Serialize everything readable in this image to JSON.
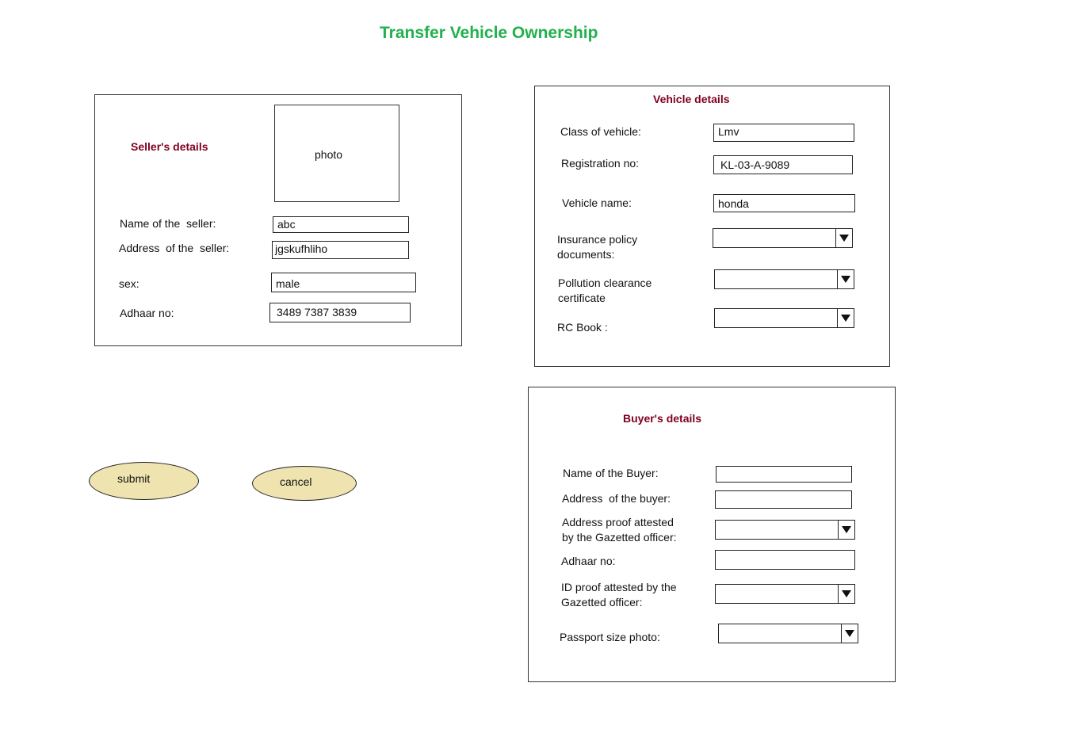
{
  "page_title": "Transfer Vehicle Ownership",
  "seller": {
    "heading": "Seller's details",
    "photo_label": "photo",
    "name_label": "Name of the  seller:",
    "name_value": "abc",
    "address_label": "Address  of the  seller:",
    "address_value": "jgskufhliho",
    "sex_label": "sex:",
    "sex_value": "male",
    "adhaar_label": "Adhaar no:",
    "adhaar_value": "3489 7387 3839"
  },
  "vehicle": {
    "heading": "Vehicle details",
    "class_label": "Class of vehicle:",
    "class_value": "Lmv",
    "reg_label": "Registration no:",
    "reg_value": "KL-03-A-9089",
    "name_label": "Vehicle name:",
    "name_value": "honda",
    "insurance_label_1": "Insurance policy",
    "insurance_label_2": "documents:",
    "pollution_label_1": "Pollution clearance",
    "pollution_label_2": "certificate",
    "rc_label": "RC Book :"
  },
  "buyer": {
    "heading": "Buyer's details",
    "name_label": "Name of the Buyer:",
    "address_label": "Address  of the buyer:",
    "address_proof_label_1": "Address proof attested",
    "address_proof_label_2": "by the Gazetted officer:",
    "adhaar_label": "Adhaar no:",
    "id_proof_label_1": "ID proof attested by the",
    "id_proof_label_2": "Gazetted officer:",
    "passport_label": "Passport size photo:"
  },
  "buttons": {
    "submit": "submit",
    "cancel": "cancel"
  },
  "colors": {
    "title": "#22b14c",
    "heading": "#7f0020",
    "button_fill": "#efe4b0"
  }
}
